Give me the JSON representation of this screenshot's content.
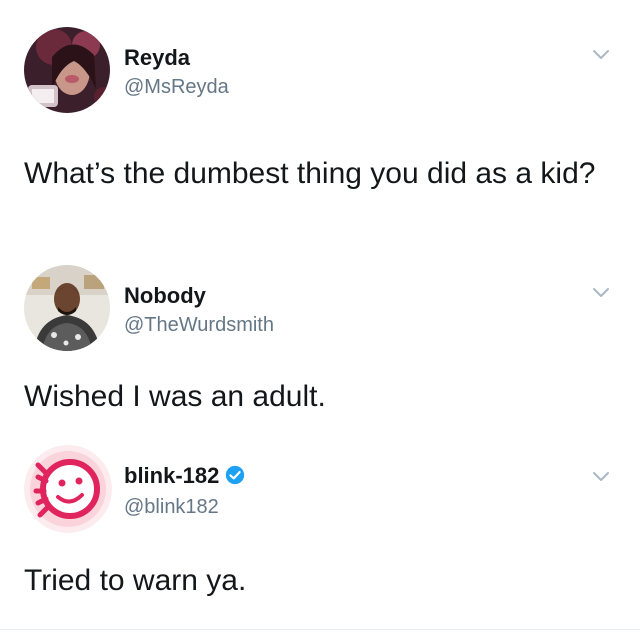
{
  "tweets": [
    {
      "display_name": "Reyda",
      "handle": "@MsReyda",
      "text": "What’s the dumbest thing you did as a kid?",
      "avatar_icon": "profile-photo",
      "menu_icon": "chevron-down-icon"
    },
    {
      "display_name": "Nobody",
      "handle": "@TheWurdsmith",
      "text": "Wished I was an adult.",
      "avatar_icon": "profile-photo",
      "menu_icon": "chevron-down-icon"
    },
    {
      "display_name": "blink-182",
      "handle": "@blink182",
      "text": "Tried to warn ya.",
      "verified": true,
      "avatar_icon": "smiley-logo",
      "menu_icon": "chevron-down-icon"
    }
  ],
  "colors": {
    "text": "#14171a",
    "handle": "#657786",
    "verified": "#1da1f2",
    "chevron": "#aab8c2",
    "blink_logo": "#e0245e"
  }
}
